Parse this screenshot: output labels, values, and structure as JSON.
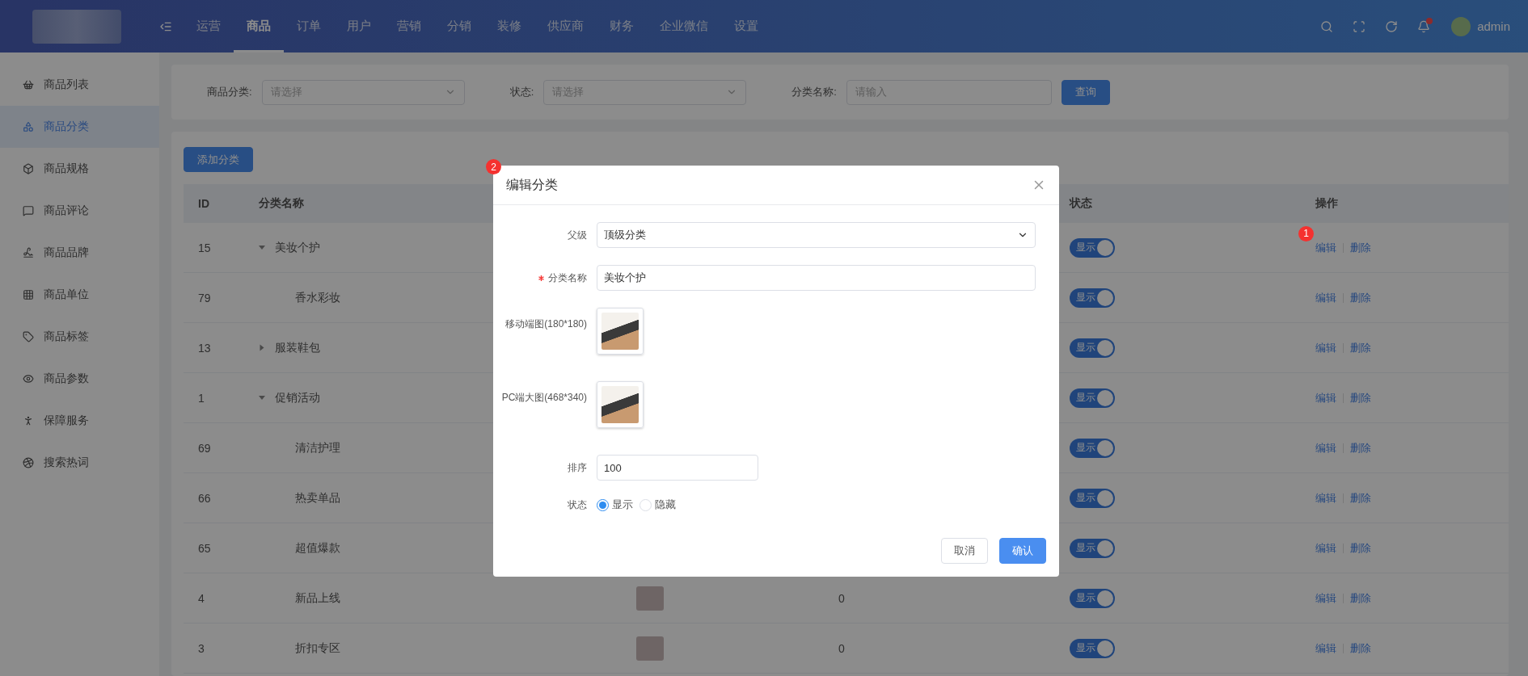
{
  "topbar": {
    "nav": [
      {
        "label": "运营",
        "selected": false
      },
      {
        "label": "商品",
        "selected": true
      },
      {
        "label": "订单",
        "selected": false
      },
      {
        "label": "用户",
        "selected": false
      },
      {
        "label": "营销",
        "selected": false
      },
      {
        "label": "分销",
        "selected": false
      },
      {
        "label": "装修",
        "selected": false
      },
      {
        "label": "供应商",
        "selected": false
      },
      {
        "label": "财务",
        "selected": false
      },
      {
        "label": "企业微信",
        "selected": false
      },
      {
        "label": "设置",
        "selected": false
      }
    ],
    "notification_dot": true,
    "user": "admin"
  },
  "sidebar": {
    "items": [
      {
        "label": "商品列表",
        "selected": false
      },
      {
        "label": "商品分类",
        "selected": true
      },
      {
        "label": "商品规格",
        "selected": false
      },
      {
        "label": "商品评论",
        "selected": false
      },
      {
        "label": "商品品牌",
        "selected": false
      },
      {
        "label": "商品单位",
        "selected": false
      },
      {
        "label": "商品标签",
        "selected": false
      },
      {
        "label": "商品参数",
        "selected": false
      },
      {
        "label": "保障服务",
        "selected": false
      },
      {
        "label": "搜索热词",
        "selected": false
      }
    ]
  },
  "filters": [
    {
      "kind": "select",
      "label": "商品分类:",
      "placeholder": "请选择"
    },
    {
      "kind": "select",
      "label": "状态:",
      "placeholder": "请选择"
    },
    {
      "kind": "input",
      "label": "分类名称:",
      "placeholder": "请输入"
    }
  ],
  "search_button": "查询",
  "add_button": "添加分类",
  "table": {
    "header": {
      "id": "ID",
      "name": "分类名称",
      "status": "状态",
      "actions": "操作"
    },
    "rows": [
      {
        "id": "15",
        "name": "美妆个护",
        "expanded": true,
        "marker": "1",
        "status": {
          "label": "显示",
          "on": true
        },
        "actions": [
          "编辑",
          "删除"
        ],
        "children": [
          {
            "id": "79",
            "name": "香水彩妆",
            "status": {
              "label": "显示",
              "on": true
            },
            "actions": [
              "编辑",
              "删除"
            ]
          }
        ]
      },
      {
        "id": "13",
        "name": "服装鞋包",
        "expanded": false,
        "status": {
          "label": "显示",
          "on": true
        },
        "actions": [
          "编辑",
          "删除"
        ]
      },
      {
        "id": "1",
        "name": "促销活动",
        "expanded": true,
        "status": {
          "label": "显示",
          "on": true
        },
        "actions": [
          "编辑",
          "删除"
        ],
        "children": [
          {
            "id": "69",
            "name": "清洁护理",
            "status": {
              "label": "显示",
              "on": true
            },
            "actions": [
              "编辑",
              "删除"
            ]
          },
          {
            "id": "66",
            "name": "热卖单品",
            "status": {
              "label": "显示",
              "on": true
            },
            "actions": [
              "编辑",
              "删除"
            ]
          },
          {
            "id": "65",
            "name": "超值爆款",
            "status": {
              "label": "显示",
              "on": true
            },
            "actions": [
              "编辑",
              "删除"
            ]
          },
          {
            "id": "4",
            "name": "新品上线",
            "image": true,
            "count": "0",
            "status": {
              "label": "显示",
              "on": true
            },
            "actions": [
              "编辑",
              "删除"
            ]
          },
          {
            "id": "3",
            "name": "折扣专区",
            "image": true,
            "count": "0",
            "status": {
              "label": "显示",
              "on": true
            },
            "actions": [
              "编辑",
              "删除"
            ]
          }
        ]
      }
    ]
  },
  "modal": {
    "title": "编辑分类",
    "marker": "2",
    "fields": [
      {
        "kind": "select",
        "label": "父级",
        "required": false,
        "value": "顶级分类"
      },
      {
        "kind": "input",
        "label": "分类名称",
        "required": true,
        "value": "美妆个护"
      },
      {
        "kind": "image",
        "label": "移动端图(180*180)",
        "required": false
      },
      {
        "kind": "image",
        "label": "PC端大图(468*340)",
        "required": false
      },
      {
        "kind": "number",
        "label": "排序",
        "required": false,
        "value": "100"
      },
      {
        "kind": "radio",
        "label": "状态",
        "required": false,
        "options": [
          {
            "label": "显示",
            "selected": true
          },
          {
            "label": "隐藏",
            "selected": false
          }
        ]
      }
    ],
    "buttons": [
      {
        "label": "取消",
        "primary": false
      },
      {
        "label": "确认",
        "primary": true
      }
    ]
  }
}
